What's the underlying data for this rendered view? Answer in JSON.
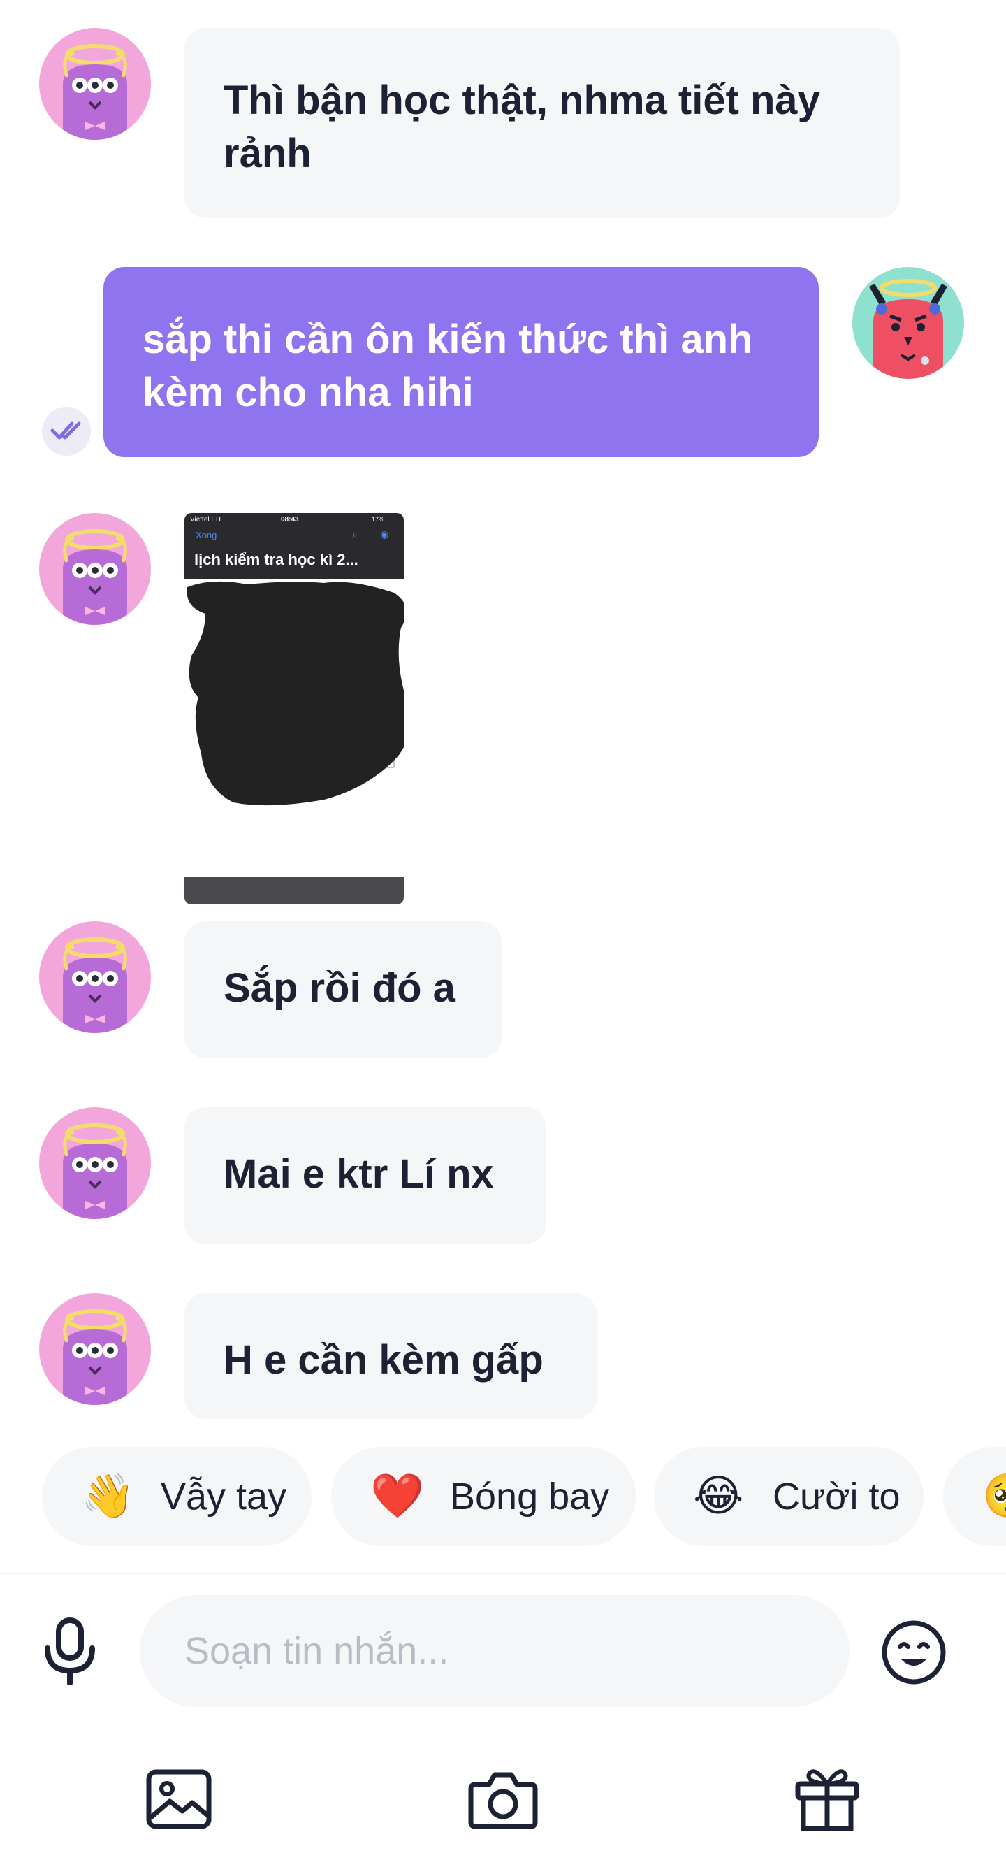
{
  "messages": [
    {
      "from": "other",
      "lines": [
        "Thì bận học thật, nhma tiết này",
        "rảnh"
      ]
    },
    {
      "from": "me",
      "lines": [
        "sắp thi cần ôn kiến thức thì anh",
        "kèm cho nha hihi"
      ],
      "status": "read"
    },
    {
      "from": "other",
      "type": "image",
      "image": {
        "carrier": "Viettel LTE",
        "time": "08:43",
        "battery": "17%",
        "nav_done": "Xong",
        "doc_title": "lịch kiểm tra học kì 2..."
      }
    },
    {
      "from": "other",
      "lines": [
        "Sắp rồi đó a"
      ]
    },
    {
      "from": "other",
      "lines": [
        "Mai e ktr Lí nx"
      ]
    },
    {
      "from": "other",
      "lines": [
        "H e cần kèm gấp"
      ]
    }
  ],
  "quick_reactions": [
    {
      "emoji": "👋",
      "label": "Vẫy tay"
    },
    {
      "emoji": "❤️",
      "label": "Bóng bay"
    },
    {
      "emoji": "😂",
      "label": "Cười to"
    },
    {
      "emoji": "🥺",
      "label": ""
    }
  ],
  "composer": {
    "placeholder": "Soạn tin nhắn..."
  },
  "icons": {
    "mic": "microphone-icon",
    "emoji": "emoji-icon",
    "gallery": "image-icon",
    "camera": "camera-icon",
    "gift": "gift-icon",
    "read": "double-check-icon"
  },
  "colors": {
    "my_bubble": "#8e74ee",
    "their_bubble": "#f5f6f8",
    "text": "#1c2233",
    "placeholder": "#b9bcc4"
  }
}
